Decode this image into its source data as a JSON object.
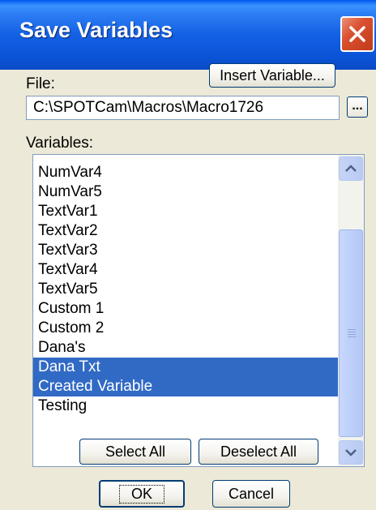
{
  "window": {
    "title": "Save Variables"
  },
  "file": {
    "label": "File:",
    "value": "C:\\SPOTCam\\Macros\\Macro1726",
    "browse_label": "..."
  },
  "insert_variable_label": "Insert Variable...",
  "variables": {
    "label": "Variables:",
    "items": [
      {
        "label": "NumVar4",
        "selected": false
      },
      {
        "label": "NumVar5",
        "selected": false
      },
      {
        "label": "TextVar1",
        "selected": false
      },
      {
        "label": "TextVar2",
        "selected": false
      },
      {
        "label": "TextVar3",
        "selected": false
      },
      {
        "label": "TextVar4",
        "selected": false
      },
      {
        "label": "TextVar5",
        "selected": false
      },
      {
        "label": "Custom 1",
        "selected": false
      },
      {
        "label": "Custom 2",
        "selected": false
      },
      {
        "label": "Dana's",
        "selected": false
      },
      {
        "label": "Dana Txt",
        "selected": true
      },
      {
        "label": "Created Variable",
        "selected": true
      },
      {
        "label": "Testing",
        "selected": false
      }
    ]
  },
  "buttons": {
    "select_all": "Select All",
    "deselect_all": "Deselect All",
    "ok": "OK",
    "cancel": "Cancel"
  },
  "colors": {
    "title_bar": "#0b54d8",
    "selection": "#316ac5",
    "dialog_bg": "#ece9d8",
    "close_button": "#d9502f"
  },
  "icons": {
    "close": "close-icon",
    "scroll_up": "scroll-up-icon",
    "scroll_down": "scroll-down-icon"
  }
}
